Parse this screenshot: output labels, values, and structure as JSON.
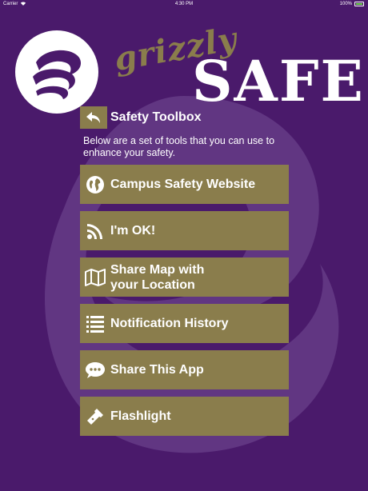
{
  "status_bar": {
    "carrier": "Carrier",
    "time": "4:30 PM",
    "battery": "100%"
  },
  "brand": {
    "grizzly": "grizzly",
    "safe": "SAFE"
  },
  "toolbox": {
    "title": "Safety Toolbox",
    "description": "Below are a set of tools that you can use to enhance your safety."
  },
  "tools": [
    {
      "label": "Campus Safety Website",
      "icon": "globe-icon"
    },
    {
      "label": "I'm OK!",
      "icon": "rss-icon"
    },
    {
      "label": "Share Map with\nyour Location",
      "icon": "map-icon"
    },
    {
      "label": "Notification History",
      "icon": "list-icon"
    },
    {
      "label": "Share This App",
      "icon": "chat-icon"
    },
    {
      "label": "Flashlight",
      "icon": "flashlight-icon"
    }
  ],
  "colors": {
    "background": "#4a1a6b",
    "gold": "#8a7d4c",
    "text": "#ffffff"
  }
}
